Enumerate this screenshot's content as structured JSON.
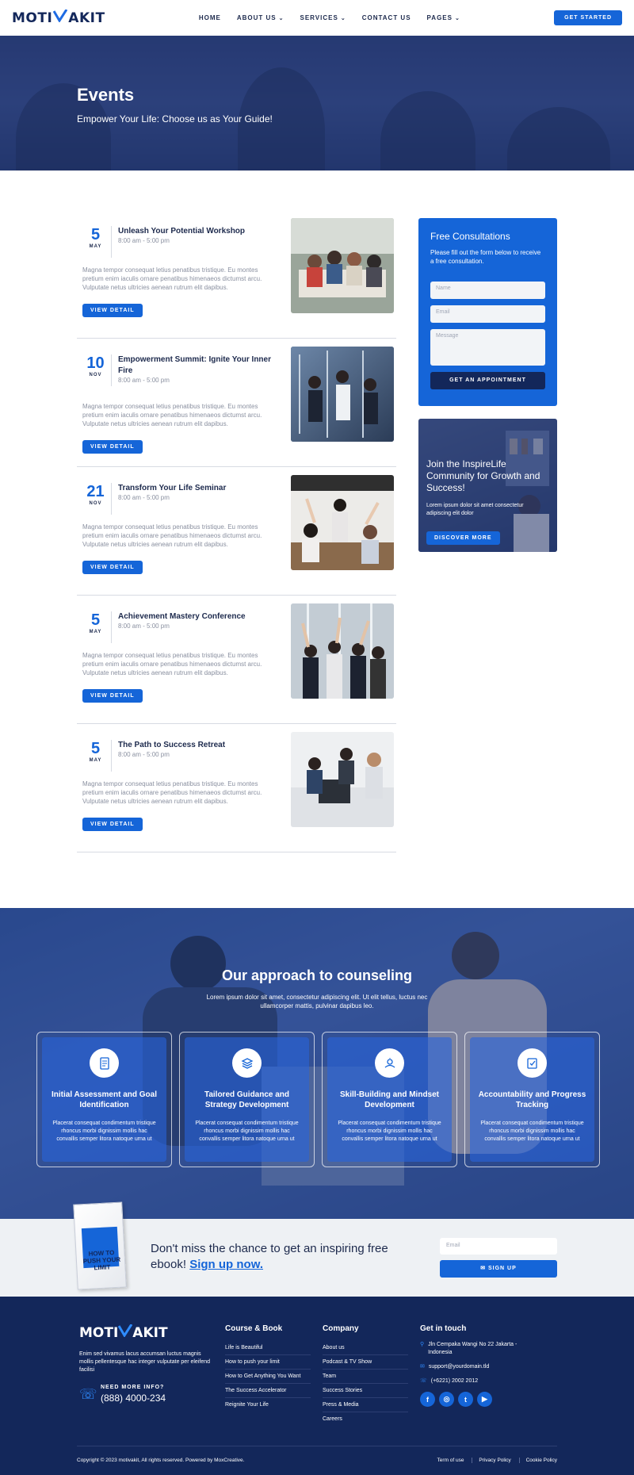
{
  "header": {
    "logo_left": "MOTI",
    "logo_right": "AKIT",
    "nav": [
      "HOME",
      "ABOUT US",
      "SERVICES",
      "CONTACT US",
      "PAGES"
    ],
    "cta": "GET STARTED"
  },
  "hero": {
    "title": "Events",
    "subtitle": "Empower Your Life: Choose us as Your Guide!"
  },
  "events": [
    {
      "day": "5",
      "month": "MAY",
      "title": "Unleash Your Potential Workshop",
      "time": "8:00 am - 5:00 pm",
      "desc": "Magna tempor consequat letius penatibus tristique. Eu montes pretium enim iaculis ornare penatibus himenaeos dictumst arcu. Vulputate netus ultricies aenean rutrum elit dapibus.",
      "button": "VIEW DETAIL"
    },
    {
      "day": "10",
      "month": "NOV",
      "title": "Empowerment Summit: Ignite Your Inner Fire",
      "time": "8:00 am - 5:00 pm",
      "desc": "Magna tempor consequat letius penatibus tristique. Eu montes pretium enim iaculis ornare penatibus himenaeos dictumst arcu. Vulputate netus ultricies aenean rutrum elit dapibus.",
      "button": "VIEW DETAIL"
    },
    {
      "day": "21",
      "month": "NOV",
      "title": "Transform Your Life Seminar",
      "time": "8:00 am - 5:00 pm",
      "desc": "Magna tempor consequat letius penatibus tristique. Eu montes pretium enim iaculis ornare penatibus himenaeos dictumst arcu. Vulputate netus ultricies aenean rutrum elit dapibus.",
      "button": "VIEW DETAIL"
    },
    {
      "day": "5",
      "month": "MAY",
      "title": "Achievement Mastery Conference",
      "time": "8:00 am - 5:00 pm",
      "desc": "Magna tempor consequat letius penatibus tristique. Eu montes pretium enim iaculis ornare penatibus himenaeos dictumst arcu. Vulputate netus ultricies aenean rutrum elit dapibus.",
      "button": "VIEW DETAIL"
    },
    {
      "day": "5",
      "month": "MAY",
      "title": "The Path to Success Retreat",
      "time": "8:00 am - 5:00 pm",
      "desc": "Magna tempor consequat letius penatibus tristique. Eu montes pretium enim iaculis ornare penatibus himenaeos dictumst arcu. Vulputate netus ultricies aenean rutrum elit dapibus.",
      "button": "VIEW DETAIL"
    }
  ],
  "consult": {
    "title": "Free Consultations",
    "text": "Please fill out the form below to receive a free consultation.",
    "name_placeholder": "Name",
    "email_placeholder": "Email",
    "message_placeholder": "Message",
    "button": "GET AN APPOINTMENT"
  },
  "community": {
    "title": "Join the InspireLife Community for Growth and Success!",
    "text": "Lorem ipsum dolor sit amet consectetur adipiscing elit dolor",
    "button": "DISCOVER MORE"
  },
  "approach": {
    "title": "Our approach to counseling",
    "subtitle": "Lorem ipsum dolor sit amet, consectetur adipiscing elit. Ut elit tellus, luctus nec ullamcorper mattis, pulvinar dapibus leo.",
    "cards": [
      {
        "icon": "document-icon",
        "title": "Initial Assessment and Goal Identification",
        "text": "Placerat consequat condimentum tristique rhoncus morbi dignissim mollis hac convallis semper litora natoque urna ut"
      },
      {
        "icon": "layers-icon",
        "title": "Tailored Guidance and Strategy Development",
        "text": "Placerat consequat condimentum tristique rhoncus morbi dignissim mollis hac convallis semper litora natoque urna ut"
      },
      {
        "icon": "mindset-icon",
        "title": "Skill-Building and Mindset Development",
        "text": "Placerat consequat condimentum tristique rhoncus morbi dignissim mollis hac convallis semper litora natoque urna ut"
      },
      {
        "icon": "checklist-icon",
        "title": "Accountability and Progress Tracking",
        "text": "Placerat consequat condimentum tristique rhoncus morbi dignissim mollis hac convallis semper litora natoque urna ut"
      }
    ]
  },
  "ebook": {
    "book_title": "HOW TO PUSH YOUR LIMIT",
    "text": "Don't miss the chance to get an inspiring free ebook!",
    "signup": "Sign up now.",
    "email_placeholder": "Email",
    "button": "SIGN UP"
  },
  "footer": {
    "logo_left": "MOTI",
    "logo_right": "AKIT",
    "desc": "Enim sed vivamus lacus accumsan luctus magnis mollis pellentesque hac integer vulputate per eleifend facilisi",
    "need_info": "NEED MORE INFO?",
    "phone": "(888) 4000-234",
    "col1_title": "Course & Book",
    "col1": [
      "Life is Beautiful",
      "How to push your limit",
      "How to Get Anything You Want",
      "The Success Accelerator",
      "Reignite Your Life"
    ],
    "col2_title": "Company",
    "col2": [
      "About us",
      "Podcast & TV Show",
      "Team",
      "Success Stories",
      "Press & Media",
      "Careers"
    ],
    "col3_title": "Get in touch",
    "address": "Jln Cempaka Wangi No 22 Jakarta - Indonesia",
    "email": "support@yourdomain.tld",
    "tel": "(+6221) 2002 2012",
    "social": [
      "f",
      "◎",
      "t",
      "▶"
    ],
    "copyright": "Copyright © 2023 motivakit, All rights reserved. Powered by MoxCreative.",
    "bottom_links": [
      "Term of use",
      "Privacy Policy",
      "Cookie Policy"
    ]
  },
  "colors": {
    "primary": "#1565d8",
    "navy": "#13275a",
    "text": "#1d2a4d"
  }
}
